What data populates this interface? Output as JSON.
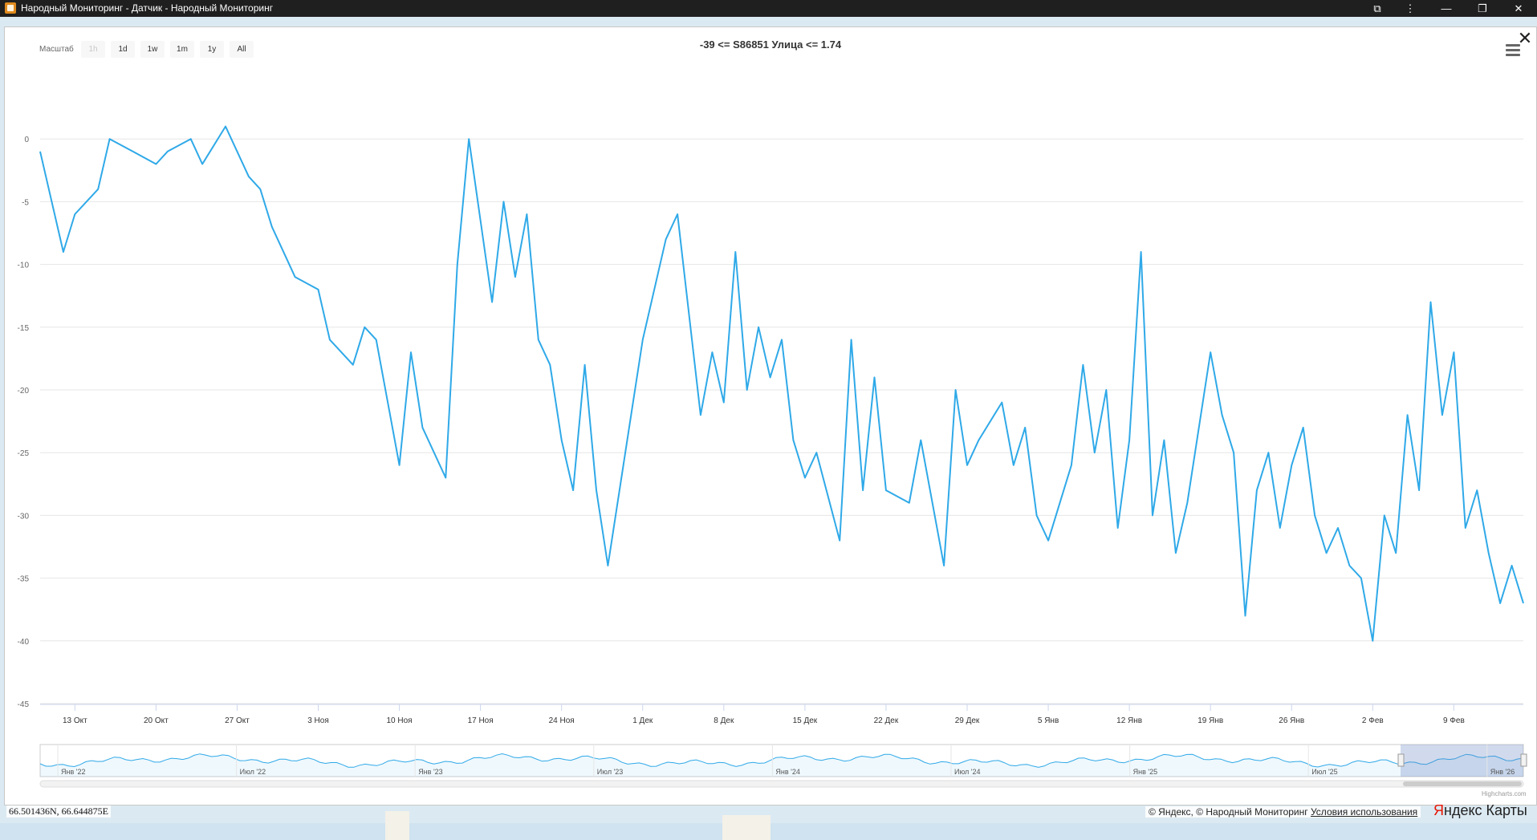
{
  "window": {
    "title": "Народный Мониторинг - Датчик - Народный Мониторинг",
    "controls": [
      "⧉",
      "⋮",
      "—",
      "❐",
      "✕"
    ]
  },
  "panel": {
    "close_label": "✕"
  },
  "range_selector": {
    "label": "Масштаб",
    "buttons": [
      "1h",
      "1d",
      "1w",
      "1m",
      "1y",
      "All"
    ],
    "disabled": [
      "1h"
    ]
  },
  "chart_data": {
    "type": "line",
    "title": "-39 <= S86851 Улица <= 1.74",
    "ylim": [
      -45,
      5
    ],
    "yticks": [
      0,
      -5,
      -10,
      -15,
      -20,
      -25,
      -30,
      -35,
      -40,
      -45
    ],
    "x_range": [
      "2025-10-10",
      "2026-02-15"
    ],
    "xticks": [
      "13 Окт",
      "20 Окт",
      "27 Окт",
      "3 Ноя",
      "10 Ноя",
      "17 Ноя",
      "24 Ноя",
      "1 Дек",
      "8 Дек",
      "15 Дек",
      "22 Дек",
      "29 Дек",
      "5 Янв",
      "12 Янв",
      "19 Янв",
      "26 Янв",
      "2 Фев",
      "9 Фев"
    ],
    "grid": true,
    "line_color": "#2fa9e8",
    "series": [
      {
        "x": [
          "2025-10-10",
          "2025-10-12",
          "2025-10-13",
          "2025-10-15",
          "2025-10-16",
          "2025-10-18",
          "2025-10-20",
          "2025-10-21",
          "2025-10-23",
          "2025-10-24",
          "2025-10-26",
          "2025-10-28",
          "2025-10-29",
          "2025-10-30",
          "2025-11-01",
          "2025-11-03",
          "2025-11-04",
          "2025-11-06",
          "2025-11-07",
          "2025-11-08",
          "2025-11-10",
          "2025-11-11",
          "2025-11-12",
          "2025-11-14",
          "2025-11-15",
          "2025-11-16",
          "2025-11-18",
          "2025-11-19",
          "2025-11-20",
          "2025-11-21",
          "2025-11-22",
          "2025-11-23",
          "2025-11-24",
          "2025-11-25",
          "2025-11-26",
          "2025-11-27",
          "2025-11-28",
          "2025-11-30",
          "2025-12-01",
          "2025-12-03",
          "2025-12-04",
          "2025-12-06",
          "2025-12-07",
          "2025-12-08",
          "2025-12-09",
          "2025-12-10",
          "2025-12-11",
          "2025-12-12",
          "2025-12-13",
          "2025-12-14",
          "2025-12-15",
          "2025-12-16",
          "2025-12-18",
          "2025-12-19",
          "2025-12-20",
          "2025-12-21",
          "2025-12-22",
          "2025-12-24",
          "2025-12-25",
          "2025-12-27",
          "2025-12-28",
          "2025-12-29",
          "2025-12-30",
          "2026-01-01",
          "2026-01-02",
          "2026-01-03",
          "2026-01-04",
          "2026-01-05",
          "2026-01-07",
          "2026-01-08",
          "2026-01-09",
          "2026-01-10",
          "2026-01-11",
          "2026-01-12",
          "2026-01-13",
          "2026-01-14",
          "2026-01-15",
          "2026-01-16",
          "2026-01-17",
          "2026-01-19",
          "2026-01-20",
          "2026-01-21",
          "2026-01-22",
          "2026-01-23",
          "2026-01-24",
          "2026-01-25",
          "2026-01-26",
          "2026-01-27",
          "2026-01-28",
          "2026-01-29",
          "2026-01-30",
          "2026-01-31",
          "2026-02-01",
          "2026-02-02",
          "2026-02-03",
          "2026-02-04",
          "2026-02-05",
          "2026-02-06",
          "2026-02-07",
          "2026-02-08",
          "2026-02-09",
          "2026-02-10",
          "2026-02-11",
          "2026-02-12",
          "2026-02-13",
          "2026-02-14",
          "2026-02-15"
        ],
        "y": [
          -1,
          -9,
          -6,
          -4,
          0,
          -1,
          -2,
          -1,
          0,
          -2,
          1,
          -3,
          -4,
          -7,
          -11,
          -12,
          -16,
          -18,
          -15,
          -16,
          -26,
          -17,
          -23,
          -27,
          -10,
          0,
          -13,
          -5,
          -11,
          -6,
          -16,
          -18,
          -24,
          -28,
          -18,
          -28,
          -34,
          -22,
          -16,
          -8,
          -6,
          -22,
          -17,
          -21,
          -9,
          -20,
          -15,
          -19,
          -16,
          -24,
          -27,
          -25,
          -32,
          -16,
          -28,
          -19,
          -28,
          -29,
          -24,
          -34,
          -20,
          -26,
          -24,
          -21,
          -26,
          -23,
          -30,
          -32,
          -26,
          -18,
          -25,
          -20,
          -31,
          -24,
          -9,
          -30,
          -24,
          -33,
          -29,
          -17,
          -22,
          -25,
          -38,
          -28,
          -25,
          -31,
          -26,
          -23,
          -30,
          -33,
          -31,
          -34,
          -35,
          -40,
          -30,
          -33,
          -22,
          -28,
          -13,
          -22,
          -17,
          -31,
          -28,
          -33,
          -37,
          -34,
          -37
        ]
      }
    ],
    "navigator": {
      "xticks": [
        "Янв '22",
        "Июл '22",
        "Янв '23",
        "Июл '23",
        "Янв '24",
        "Июл '24",
        "Янв '25",
        "Июл '25",
        "Янв '26"
      ]
    }
  },
  "credits": "Highcharts.com",
  "map": {
    "coords": "66.501436N, 66.644875E",
    "attribution": "© Яндекс, © Народный Мониторинг",
    "terms_link": "Условия использования",
    "logo_red": "Я",
    "logo_rest": "ндекс Карты"
  }
}
